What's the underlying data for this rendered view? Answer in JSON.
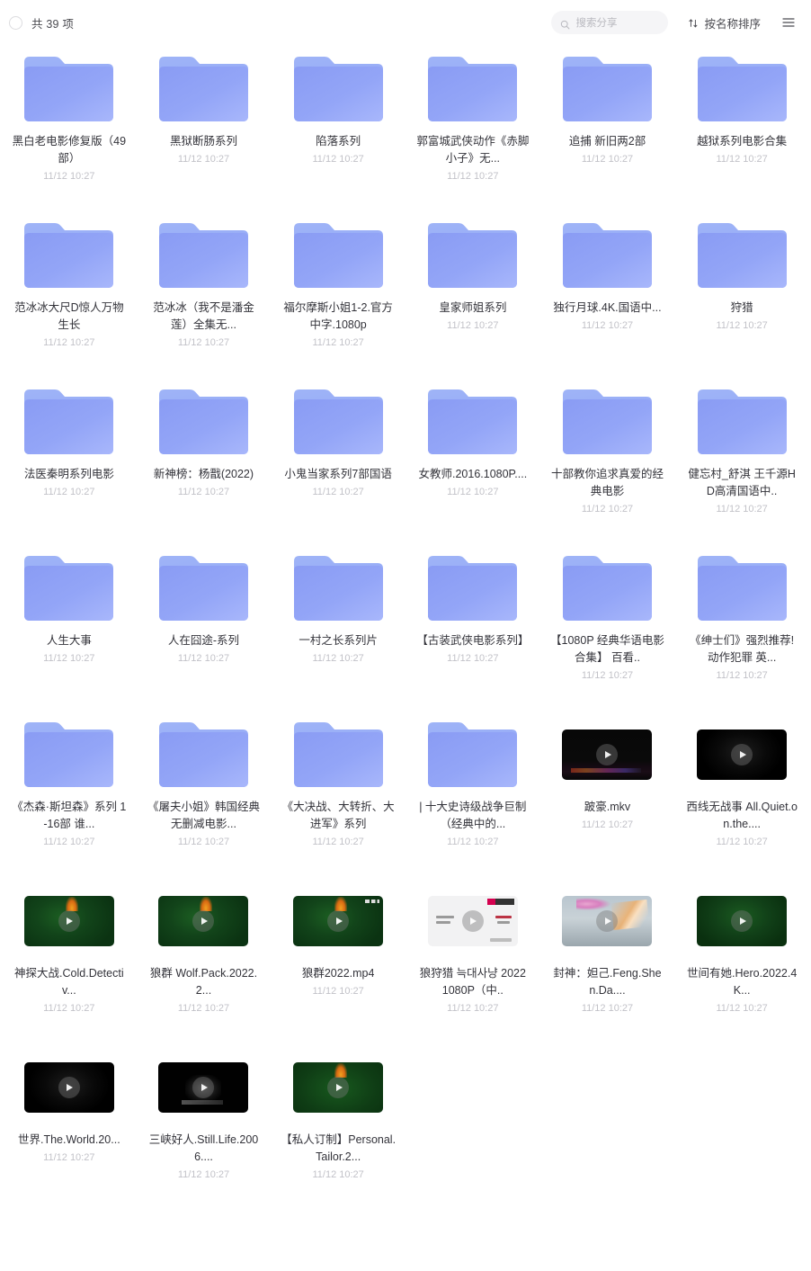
{
  "toolbar": {
    "select_all_name": "select-all-checkbox",
    "count_label": "共 39 项",
    "search_placeholder": "搜索分享",
    "sort_label": "按名称排序",
    "view_toggle_name": "list-view-toggle"
  },
  "colors": {
    "folder_top": "#9fb4f7",
    "folder_body_start": "#8a9cf4",
    "folder_body_end": "#a7b6fb",
    "text_primary": "#33333a",
    "text_muted": "#c2c2c8",
    "search_bg": "#f5f5f7"
  },
  "items": [
    {
      "type": "folder",
      "name": "黑白老电影修复版（49部）",
      "date": "11/12 10:27"
    },
    {
      "type": "folder",
      "name": "黑狱断肠系列",
      "date": "11/12 10:27"
    },
    {
      "type": "folder",
      "name": "陷落系列",
      "date": "11/12 10:27"
    },
    {
      "type": "folder",
      "name": "郭富城武侠动作《赤脚小子》无...",
      "date": "11/12 10:27"
    },
    {
      "type": "folder",
      "name": "追捕 新旧两2部",
      "date": "11/12 10:27"
    },
    {
      "type": "folder",
      "name": "越狱系列电影合集",
      "date": "11/12 10:27"
    },
    {
      "type": "folder",
      "name": "范冰冰大尺D惊人万物生长",
      "date": "11/12 10:27"
    },
    {
      "type": "folder",
      "name": "范冰冰（我不是潘金莲）全集无...",
      "date": "11/12 10:27"
    },
    {
      "type": "folder",
      "name": "福尔摩斯小姐1-2.官方中字.1080p",
      "date": "11/12 10:27"
    },
    {
      "type": "folder",
      "name": "皇家师姐系列",
      "date": "11/12 10:27"
    },
    {
      "type": "folder",
      "name": "独行月球.4K.国语中...",
      "date": "11/12 10:27"
    },
    {
      "type": "folder",
      "name": "狩猎",
      "date": "11/12 10:27"
    },
    {
      "type": "folder",
      "name": "法医秦明系列电影",
      "date": "11/12 10:27"
    },
    {
      "type": "folder",
      "name": "新神榜：杨戬(2022)",
      "date": "11/12 10:27"
    },
    {
      "type": "folder",
      "name": "小鬼当家系列7部国语",
      "date": "11/12 10:27"
    },
    {
      "type": "folder",
      "name": "女教师.2016.1080P....",
      "date": "11/12 10:27"
    },
    {
      "type": "folder",
      "name": "十部教你追求真爱的经典电影",
      "date": "11/12 10:27"
    },
    {
      "type": "folder",
      "name": "健忘村_舒淇 王千源HD高清国语中..",
      "date": "11/12 10:27"
    },
    {
      "type": "folder",
      "name": "人生大事",
      "date": "11/12 10:27"
    },
    {
      "type": "folder",
      "name": "人在囧途-系列",
      "date": "11/12 10:27"
    },
    {
      "type": "folder",
      "name": "一村之长系列片",
      "date": "11/12 10:27"
    },
    {
      "type": "folder",
      "name": "【古装武侠电影系列】",
      "date": "11/12 10:27"
    },
    {
      "type": "folder",
      "name": "【1080P 经典华语电影合集】 百看..",
      "date": "11/12 10:27"
    },
    {
      "type": "folder",
      "name": "《绅士们》强烈推荐! 动作犯罪 英...",
      "date": "11/12 10:27"
    },
    {
      "type": "folder",
      "name": "《杰森·斯坦森》系列 1-16部 谁...",
      "date": "11/12 10:27"
    },
    {
      "type": "folder",
      "name": "《屠夫小姐》韩国经典无删减电影...",
      "date": "11/12 10:27"
    },
    {
      "type": "folder",
      "name": "《大决战、大转折、大进军》系列",
      "date": "11/12 10:27"
    },
    {
      "type": "folder",
      "name": "| 十大史诗级战争巨制（经典中的...",
      "date": "11/12 10:27"
    },
    {
      "type": "video",
      "style": "th-dark-strip",
      "deco": [
        "strip-colors"
      ],
      "name": "跛豪.mkv",
      "date": "11/12 10:27"
    },
    {
      "type": "video",
      "style": "th-black",
      "deco": [],
      "name": "西线无战事 All.Quiet.on.the....",
      "date": "11/12 10:27"
    },
    {
      "type": "video",
      "style": "th-green",
      "deco": [
        "gr-flame"
      ],
      "name": "神探大战.Cold.Detectiv...",
      "date": "11/12 10:27"
    },
    {
      "type": "video",
      "style": "th-green",
      "deco": [
        "gr-flame"
      ],
      "name": "狼群 Wolf.Pack.2022.2...",
      "date": "11/12 10:27"
    },
    {
      "type": "video",
      "style": "th-green",
      "deco": [
        "gr-flame",
        "tiny-icons"
      ],
      "name": "狼群2022.mp4",
      "date": "11/12 10:27"
    },
    {
      "type": "video",
      "style": "th-white",
      "deco": [
        "dk-badge",
        "dk-line1",
        "dk-line2",
        "dk-line3",
        "dk-line4",
        "dk-line5"
      ],
      "name": "狼狩猎 늑대사냥 2022 1080P（中..",
      "date": "11/12 10:27"
    },
    {
      "type": "video",
      "style": "th-sky",
      "deco": [
        "sky-sun",
        "sky-streak"
      ],
      "name": "封神：妲己.Feng.Shen.Da....",
      "date": "11/12 10:27"
    },
    {
      "type": "video",
      "style": "th-green-dark",
      "deco": [],
      "name": "世间有她.Hero.2022.4K...",
      "date": "11/12 10:27"
    },
    {
      "type": "video",
      "style": "th-black",
      "deco": [],
      "name": "世界.The.World.20...",
      "date": "11/12 10:27"
    },
    {
      "type": "video",
      "style": "th-black2",
      "deco": [
        "bl-logo",
        "bl-text"
      ],
      "name": "三峡好人.Still.Life.2006....",
      "date": "11/12 10:27"
    },
    {
      "type": "video",
      "style": "th-green-deep",
      "deco": [
        "gr-flame"
      ],
      "name": "【私人订制】Personal.Tailor.2...",
      "date": "11/12 10:27"
    }
  ]
}
